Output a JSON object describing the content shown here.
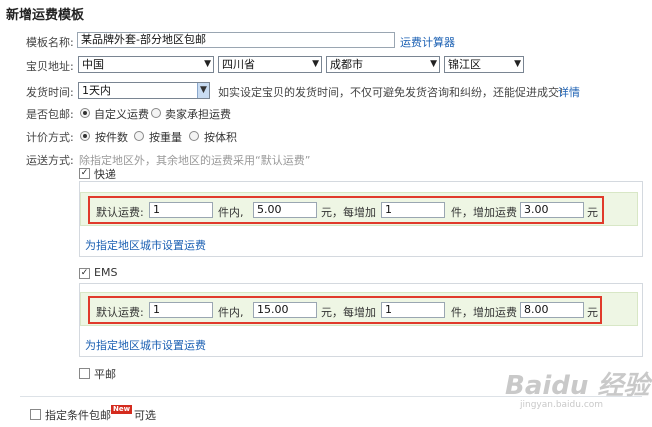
{
  "title": "新增运费模板",
  "template_name": {
    "label": "模板名称:",
    "value": "某品牌外套-部分地区包邮",
    "calc_link": "运费计算器"
  },
  "address": {
    "label": "宝贝地址:",
    "country": "中国",
    "province": "四川省",
    "city": "成都市",
    "district": "锦江区"
  },
  "ship_time": {
    "label": "发货时间:",
    "value": "1天内",
    "hint": "如实设定宝贝的发货时间，不仅可避免发货咨询和纠纷，还能促进成交!",
    "hint_link": "详情"
  },
  "free_shipping": {
    "label": "是否包邮:",
    "options": [
      "自定义运费",
      "卖家承担运费"
    ],
    "selected": 0
  },
  "pricing": {
    "label": "计价方式:",
    "options": [
      "按件数",
      "按重量",
      "按体积"
    ],
    "selected": 0
  },
  "delivery": {
    "label": "运送方式:",
    "hint": "除指定地区外，其余地区的运费采用“默认运费”"
  },
  "methods": [
    {
      "name": "快递",
      "checked": true,
      "default_label": "默认运费:",
      "first_qty": "1",
      "unit_within": "件内,",
      "first_fee": "5.00",
      "yuan_each": "元，每增加",
      "add_qty": "1",
      "add_fee_label": "件，增加运费",
      "add_fee": "3.00",
      "yuan": "元",
      "region_link": "为指定地区城市设置运费"
    },
    {
      "name": "EMS",
      "checked": true,
      "default_label": "默认运费:",
      "first_qty": "1",
      "unit_within": "件内,",
      "first_fee": "15.00",
      "yuan_each": "元，每增加",
      "add_qty": "1",
      "add_fee_label": "件，增加运费",
      "add_fee": "8.00",
      "yuan": "元",
      "region_link": "为指定地区城市设置运费"
    },
    {
      "name": "平邮",
      "checked": false
    }
  ],
  "conditional_free": {
    "label": "指定条件包邮",
    "badge": "New",
    "optional": "可选"
  },
  "watermark": {
    "brand": "Baidu 经验",
    "url": "jingyan.baidu.com"
  },
  "colors": {
    "link": "#1b60b3",
    "highlight": "#e03a2b",
    "panel_bg": "#eef6e4"
  },
  "icons": {
    "check": "✓",
    "dropdown": "▼"
  }
}
